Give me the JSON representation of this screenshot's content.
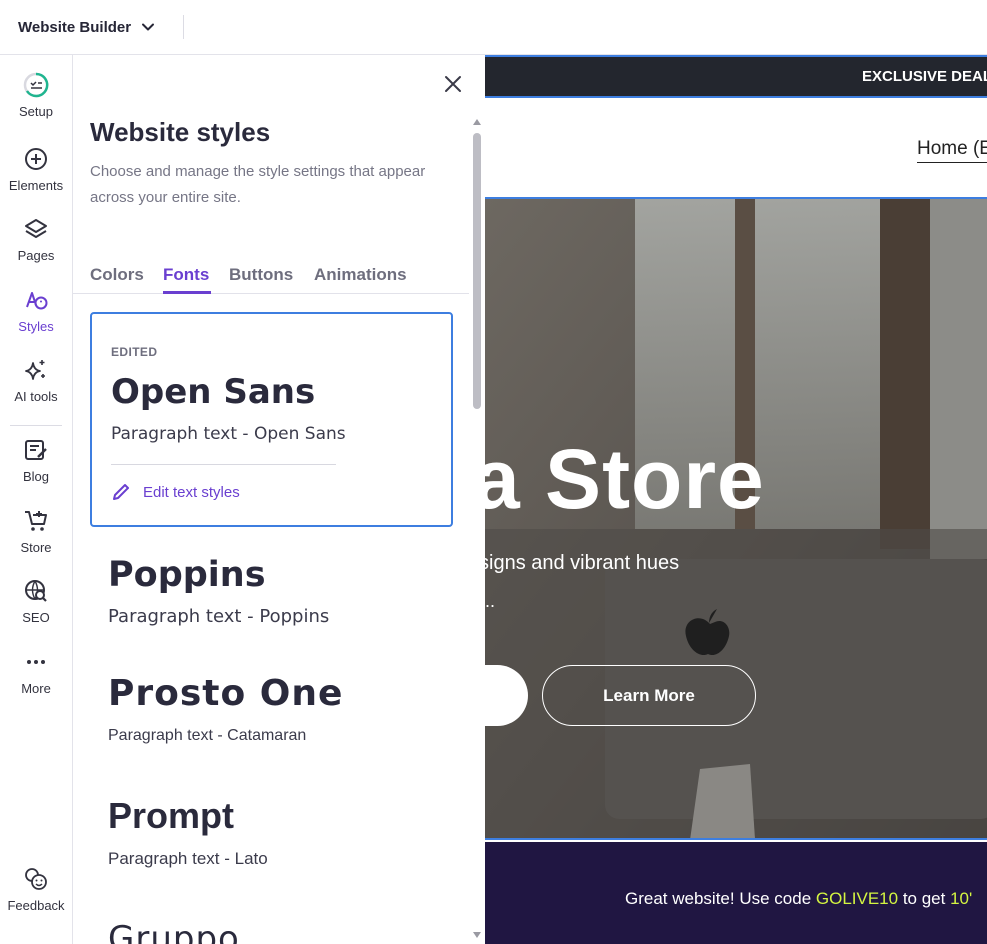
{
  "topbar": {
    "app_name": "Website Builder"
  },
  "rail": {
    "items": [
      {
        "label": "Setup",
        "icon": "setup-progress-icon"
      },
      {
        "label": "Elements",
        "icon": "plus-circle-icon"
      },
      {
        "label": "Pages",
        "icon": "layers-icon"
      },
      {
        "label": "Styles",
        "icon": "styles-palette-icon",
        "active": true
      },
      {
        "label": "AI tools",
        "icon": "sparkle-icon"
      },
      {
        "label": "Blog",
        "icon": "blog-edit-icon"
      },
      {
        "label": "Store",
        "icon": "cart-plus-icon"
      },
      {
        "label": "SEO",
        "icon": "globe-search-icon"
      },
      {
        "label": "More",
        "icon": "more-dots-icon"
      },
      {
        "label": "Feedback",
        "icon": "feedback-face-icon"
      }
    ]
  },
  "panel": {
    "title": "Website styles",
    "description": "Choose and manage the style settings that appear across your entire site.",
    "tabs": [
      {
        "label": "Colors"
      },
      {
        "label": "Fonts",
        "active": true
      },
      {
        "label": "Buttons"
      },
      {
        "label": "Animations"
      }
    ],
    "selected_font": {
      "badge": "EDITED",
      "heading": "Open Sans",
      "paragraph": "Paragraph text - Open Sans",
      "edit_link": "Edit text styles"
    },
    "fonts": [
      {
        "heading": "Poppins",
        "paragraph": "Paragraph text - Poppins"
      },
      {
        "heading": "Prosto One",
        "paragraph": "Paragraph text - Catamaran"
      },
      {
        "heading": "Prompt",
        "paragraph": "Paragraph text - Lato"
      },
      {
        "heading": "Gruppo"
      }
    ]
  },
  "preview": {
    "announcement": "EXCLUSIVE DEAL",
    "nav_home": "Home (E",
    "hero_title": "a Store",
    "hero_subtitle": "signs and vibrant hues",
    "hero_subtitle2": "..",
    "learn_more": "Learn More",
    "promo": {
      "prefix": "Great website! Use code ",
      "code": "GOLIVE10",
      "middle": " to get ",
      "discount": "10'"
    }
  },
  "colors": {
    "accent": "#6a3fd0",
    "selection_border": "#3d7ee0",
    "announcement_bg": "#23262e",
    "promo_bg": "#201642",
    "promo_code": "#d4f541"
  }
}
